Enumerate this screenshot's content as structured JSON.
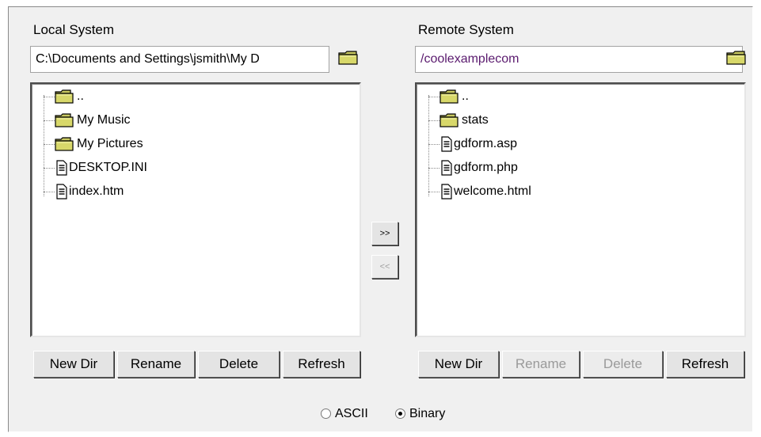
{
  "local": {
    "title": "Local System",
    "path": "C:\\Documents and Settings\\jsmith\\My D",
    "items": [
      {
        "name": "..",
        "type": "folder"
      },
      {
        "name": "My Music",
        "type": "folder"
      },
      {
        "name": "My Pictures",
        "type": "folder"
      },
      {
        "name": "DESKTOP.INI",
        "type": "file"
      },
      {
        "name": "index.htm",
        "type": "file"
      }
    ],
    "buttons": {
      "new_dir": "New Dir",
      "rename": "Rename",
      "delete": "Delete",
      "refresh": "Refresh"
    }
  },
  "remote": {
    "title": "Remote System",
    "path": "/coolexamplecom",
    "items": [
      {
        "name": "..",
        "type": "folder"
      },
      {
        "name": "stats",
        "type": "folder"
      },
      {
        "name": "gdform.asp",
        "type": "file"
      },
      {
        "name": "gdform.php",
        "type": "file"
      },
      {
        "name": "welcome.html",
        "type": "file"
      }
    ],
    "buttons": {
      "new_dir": "New Dir",
      "rename": "Rename",
      "delete": "Delete",
      "refresh": "Refresh"
    }
  },
  "transfer": {
    "upload": ">>",
    "download": "<<"
  },
  "mode": {
    "ascii": "ASCII",
    "binary": "Binary",
    "selected": "binary"
  },
  "colors": {
    "folder": "#d8d86a",
    "remote_path_text": "#5a1a6e"
  }
}
